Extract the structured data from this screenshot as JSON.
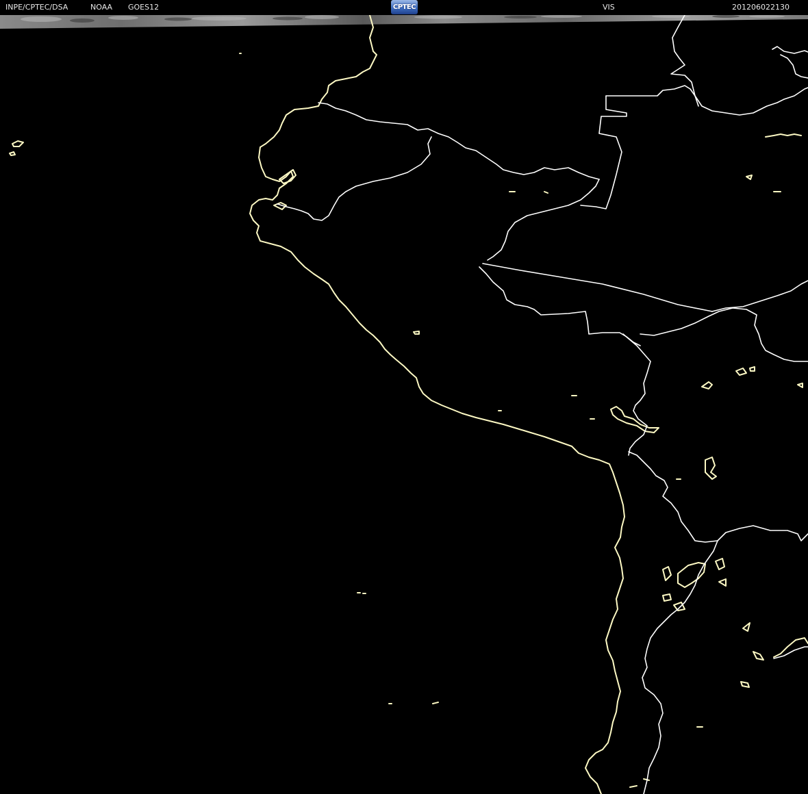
{
  "header": {
    "source": "INPE/CPTEC/DSA",
    "agency": "NOAA",
    "satellite": "GOES12",
    "band": "VIS",
    "timestamp": "201206022130"
  },
  "logo": {
    "text": "CPTEC",
    "icon": "cptec-logo-icon"
  },
  "colors": {
    "background": "#000000",
    "coastline": "#fdf9c4",
    "border": "#ffffff",
    "header_text": "#e8e8e8"
  }
}
